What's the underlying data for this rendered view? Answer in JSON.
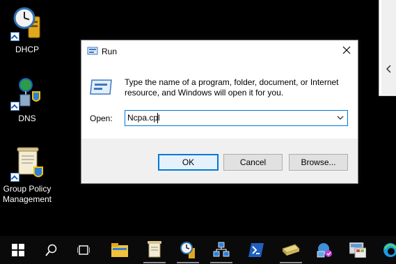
{
  "desktop": {
    "icons": [
      {
        "label": "DHCP",
        "icon": "dhcp-clock-icon"
      },
      {
        "label": "DNS",
        "icon": "dns-globe-icon"
      },
      {
        "label": "Group Policy Management",
        "label_line1": "Group Policy",
        "label_line2": "Management",
        "icon": "group-policy-scroll-icon"
      }
    ]
  },
  "dialog": {
    "title": "Run",
    "description_line1": "Type the name of a program, folder, document, or Internet",
    "description_line2": "resource, and Windows will open it for you.",
    "open_label": "Open:",
    "input_value": "Ncpa.cpl",
    "buttons": {
      "ok": "OK",
      "cancel": "Cancel",
      "browse": "Browse..."
    }
  },
  "taskbar": {
    "items": [
      "start-icon",
      "search-icon",
      "task-view-icon",
      "file-explorer-icon",
      "group-policy-icon",
      "dhcp-icon",
      "network-icon",
      "powershell-icon",
      "server-manager-icon",
      "network-sharing-icon",
      "control-panel-icon",
      "edge-icon"
    ]
  },
  "colors": {
    "accent": "#0078d7",
    "dialog_bg": "#f0f0f0",
    "desktop_bg": "#000000"
  }
}
